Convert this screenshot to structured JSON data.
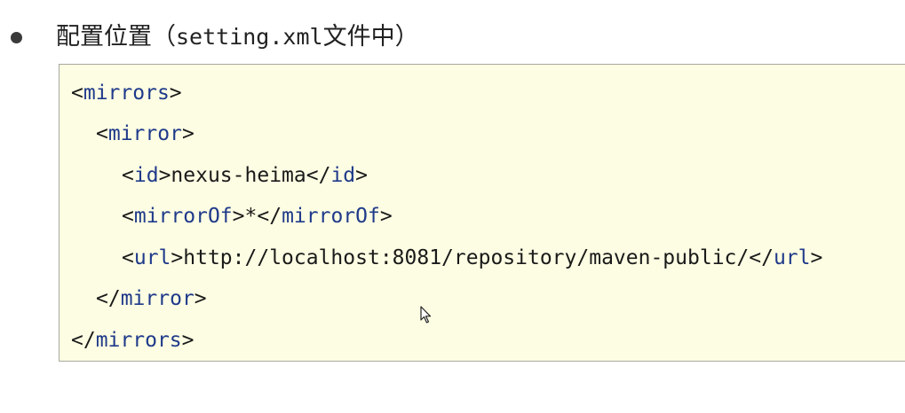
{
  "heading": {
    "prefix": "配置位置（",
    "file": "setting.xml",
    "suffix": "文件中）"
  },
  "code": {
    "line1": {
      "tag": "mirrors"
    },
    "line2": {
      "tag": "mirror"
    },
    "line3": {
      "tag": "id",
      "value": "nexus-heima"
    },
    "line4": {
      "tag": "mirrorOf",
      "value": "*"
    },
    "line5": {
      "tag": "url",
      "value": "http://localhost:8081/repository/maven-public/"
    },
    "line6": {
      "tag": "mirror"
    },
    "line7": {
      "tag": "mirrors"
    }
  },
  "colors": {
    "tag": "#1f3a8a",
    "code_background": "#fdfde3",
    "border": "#a8a8a0"
  },
  "icons": {
    "bullet": "bullet-dot-icon",
    "pointer": "mouse-pointer-icon"
  }
}
